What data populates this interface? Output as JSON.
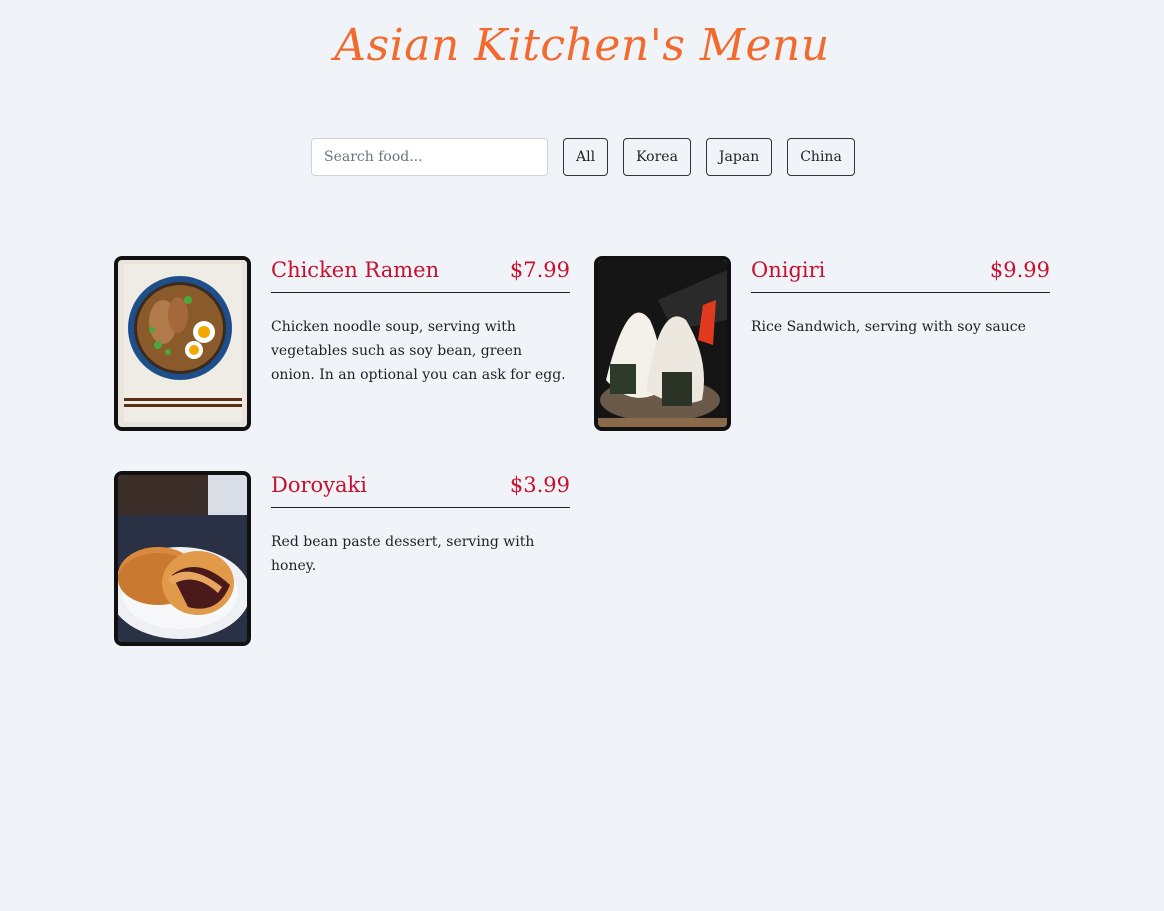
{
  "header": {
    "title": "Asian Kitchen's Menu"
  },
  "search": {
    "placeholder": "Search food..."
  },
  "filters": [
    "All",
    "Korea",
    "Japan",
    "China"
  ],
  "items": [
    {
      "name": "Chicken Ramen",
      "price": "$7.99",
      "description": "Chicken noodle soup, serving with vegetables such as soy bean, green onion. In an optional you can ask for egg.",
      "photo": "ramen-photo"
    },
    {
      "name": "Onigiri",
      "price": "$9.99",
      "description": "Rice Sandwich, serving with soy sauce",
      "photo": "onigiri-photo"
    },
    {
      "name": "Doroyaki",
      "price": "$3.99",
      "description": "Red bean paste dessert, serving with honey.",
      "photo": "dorayaki-photo"
    }
  ],
  "colors": {
    "background": "#f0f4f8",
    "title": "#f26a2e",
    "item_accent": "#c8102e"
  }
}
